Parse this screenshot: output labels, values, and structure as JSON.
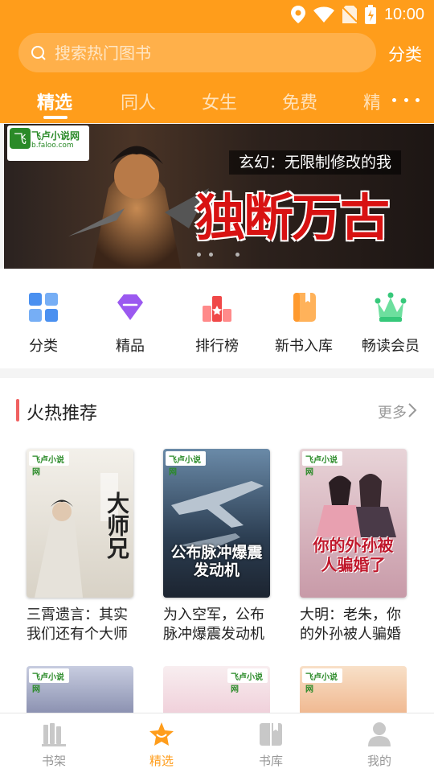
{
  "status_bar": {
    "time": "10:00"
  },
  "search": {
    "placeholder": "搜索热门图书"
  },
  "header": {
    "category_label": "分类"
  },
  "tabs": [
    {
      "label": "精选",
      "active": true
    },
    {
      "label": "同人"
    },
    {
      "label": "女生"
    },
    {
      "label": "免费"
    },
    {
      "label": "精"
    }
  ],
  "banner": {
    "logo_text": "飞卢小说网",
    "logo_sub": "b.faloo.com",
    "subtitle": "玄幻：无限制修改的我",
    "title": "独断万古",
    "page_count": 3
  },
  "quick_links": [
    {
      "label": "分类",
      "icon": "grid-icon",
      "color": "#4a90f0"
    },
    {
      "label": "精品",
      "icon": "diamond-icon",
      "color": "#9b59f0"
    },
    {
      "label": "排行榜",
      "icon": "ranking-icon",
      "color": "#f04848"
    },
    {
      "label": "新书入库",
      "icon": "book-icon",
      "color": "#ff9a2e"
    },
    {
      "label": "畅读会员",
      "icon": "crown-icon",
      "color": "#36c87a"
    }
  ],
  "hot": {
    "title": "火热推荐",
    "more_label": "更多",
    "books": [
      {
        "name": "三霄遗言：其实我们还有个大师兄",
        "cover_title": "大师兄"
      },
      {
        "name": "为入空军，公布脉冲爆震发动机",
        "cover_title": "公布脉冲爆震发动机"
      },
      {
        "name": "大明：老朱，你的外孙被人骗婚了",
        "cover_title": "你的外孙被人骗婚了"
      }
    ],
    "cover_badge": "飞卢小说网"
  },
  "bottom_nav": [
    {
      "label": "书架",
      "icon": "bookshelf-icon"
    },
    {
      "label": "精选",
      "icon": "star-icon",
      "active": true
    },
    {
      "label": "书库",
      "icon": "library-icon"
    },
    {
      "label": "我的",
      "icon": "profile-icon"
    }
  ],
  "colors": {
    "primary": "#ff9d1b",
    "accent_red": "#f06060"
  }
}
